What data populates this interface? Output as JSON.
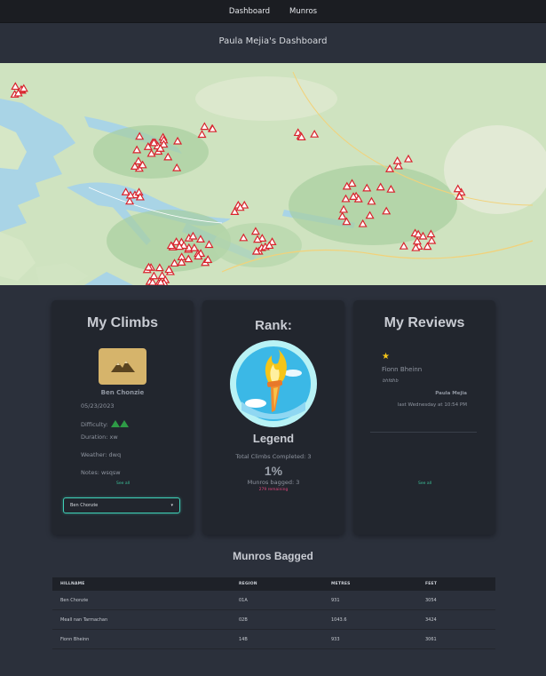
{
  "nav": {
    "items": [
      "Dashboard",
      "Munros"
    ]
  },
  "page": {
    "title": "Paula Mejia's Dashboard"
  },
  "climbs": {
    "title": "My Climbs",
    "hill_name": "Ben Chonzie",
    "date": "05/23/2023",
    "difficulty_label": "Difficulty:",
    "difficulty_level": 2,
    "duration": "Duration: xw",
    "weather": "Weather: dwq",
    "notes": "Notes: wsqsw",
    "see_all": "See all",
    "select_value": "Ben Chonzie"
  },
  "rank": {
    "title": "Rank:",
    "level": "Legend",
    "total": "Total Climbs Completed: 3",
    "percent": "1%",
    "bagged": "Munros bagged: 3",
    "remaining": "279 remaining"
  },
  "reviews": {
    "title": "My Reviews",
    "rating": 1,
    "hill_name": "Fionn Bheinn",
    "text": "bhfdhb",
    "author": "Paula Mejia",
    "time": "last Wednesday at 10:54 PM",
    "see_all": "See all"
  },
  "bagged": {
    "title": "Munros Bagged",
    "columns": [
      "HILLNAME",
      "REGION",
      "METRES",
      "FEET"
    ],
    "rows": [
      [
        "Ben Chonzie",
        "01A",
        "931",
        "3054"
      ],
      [
        "Meall nan Tarmachan",
        "02B",
        "1043.6",
        "3424"
      ],
      [
        "Fionn Bheinn",
        "14B",
        "933",
        "3061"
      ]
    ]
  },
  "colors": {
    "accent": "#3cc19a",
    "remaining": "#e0457b",
    "difficulty": "#2e9b46",
    "star": "#f5c518",
    "select_border": "#3fd0b7"
  }
}
